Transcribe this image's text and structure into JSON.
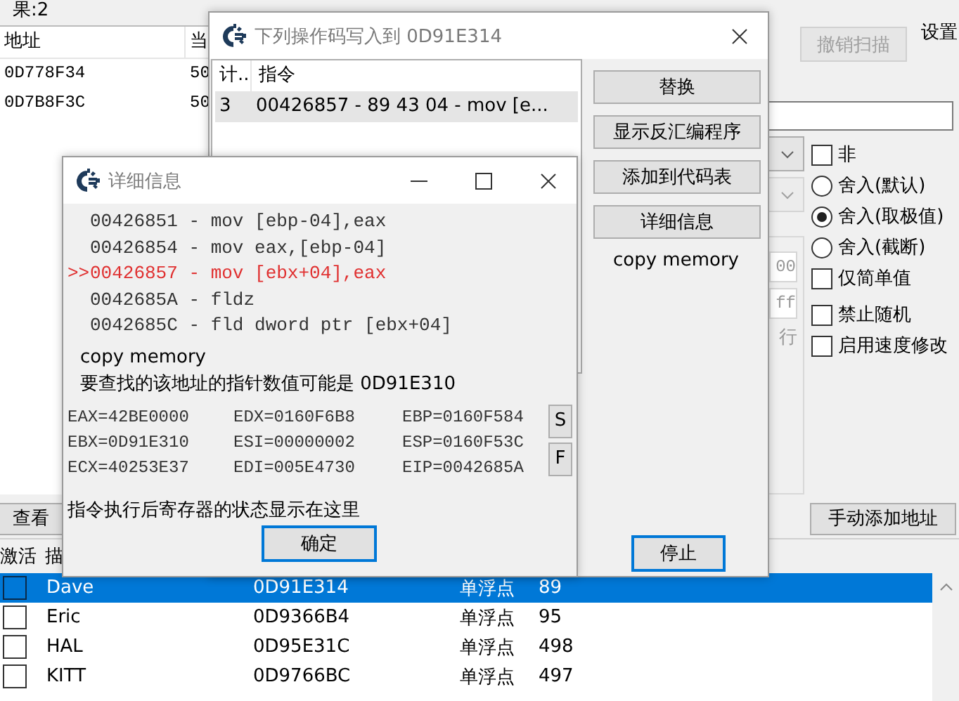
{
  "main_window": {
    "result_count": "果:2",
    "results": {
      "columns": [
        "地址",
        "当"
      ],
      "rows": [
        {
          "address": "0D778F34",
          "value": "50"
        },
        {
          "address": "0D7B8F3C",
          "value": "50"
        }
      ]
    },
    "undo_scan_button": {
      "label": "撤销扫描",
      "disabled": true
    },
    "settings_label": "设置",
    "dropdowns": [
      {
        "disabled": false
      },
      {
        "disabled": true
      }
    ],
    "hex_fields": [
      "00",
      "ff"
    ],
    "cut_label": "行",
    "options": [
      {
        "kind": "checkbox",
        "label": "非",
        "checked": false
      },
      {
        "kind": "radio",
        "label": "舍入(默认)",
        "selected": false
      },
      {
        "kind": "radio",
        "label": "舍入(取极值)",
        "selected": true
      },
      {
        "kind": "radio",
        "label": "舍入(截断)",
        "selected": false
      },
      {
        "kind": "checkbox",
        "label": "仅简单值",
        "checked": false
      },
      {
        "kind": "checkbox",
        "label": "禁止随机",
        "checked": false
      },
      {
        "kind": "checkbox",
        "label": "启用速度修改",
        "checked": false
      }
    ],
    "view_button": "查看",
    "add_address_button": "手动添加地址",
    "address_list": {
      "columns": [
        "激活",
        "描"
      ],
      "rows": [
        {
          "active": false,
          "selected": true,
          "description": "Dave",
          "address": "0D91E314",
          "type": "单浮点",
          "value": "89"
        },
        {
          "active": false,
          "selected": false,
          "description": "Eric",
          "address": "0D9366B4",
          "type": "单浮点",
          "value": "95"
        },
        {
          "active": false,
          "selected": false,
          "description": "HAL",
          "address": "0D95E31C",
          "type": "单浮点",
          "value": "498"
        },
        {
          "active": false,
          "selected": false,
          "description": "KITT",
          "address": "0D9766BC",
          "type": "单浮点",
          "value": "497"
        }
      ]
    }
  },
  "opcode_dialog": {
    "title": "下列操作码写入到 0D91E314",
    "columns": [
      "计..",
      "指令"
    ],
    "rows": [
      {
        "count": "3",
        "instruction": "00426857 - 89 43 04  - mov [e...",
        "selected": true
      }
    ],
    "buttons": [
      "替换",
      "显示反汇编程序",
      "添加到代码表",
      "详细信息"
    ],
    "note": "copy memory",
    "stop_button": "停止"
  },
  "details_dialog": {
    "title": "详细信息",
    "code_lines": [
      {
        "text": "00426851 - mov [ebp-04],eax",
        "current": false
      },
      {
        "text": "00426854 - mov eax,[ebp-04]",
        "current": false
      },
      {
        "marker": ">>",
        "text": "00426857 - mov [ebx+04],eax",
        "current": true
      },
      {
        "text": "0042685A - fldz",
        "current": false
      },
      {
        "text": "0042685C - fld dword ptr [ebx+04]",
        "current": false
      }
    ],
    "comment": "copy memory",
    "pointer_hint": "要查找的该地址的指针数值可能是 0D91E310",
    "registers": [
      [
        "EAX=42BE0000",
        "EDX=0160F6B8",
        "EBP=0160F584"
      ],
      [
        "EBX=0D91E310",
        "ESI=00000002",
        "ESP=0160F53C"
      ],
      [
        "ECX=40253E37",
        "EDI=005E4730",
        "EIP=0042685A"
      ]
    ],
    "side_buttons": [
      "S",
      "F"
    ],
    "status_text": "指令执行后寄存器的状态显示在这里",
    "ok_button": "确定"
  }
}
